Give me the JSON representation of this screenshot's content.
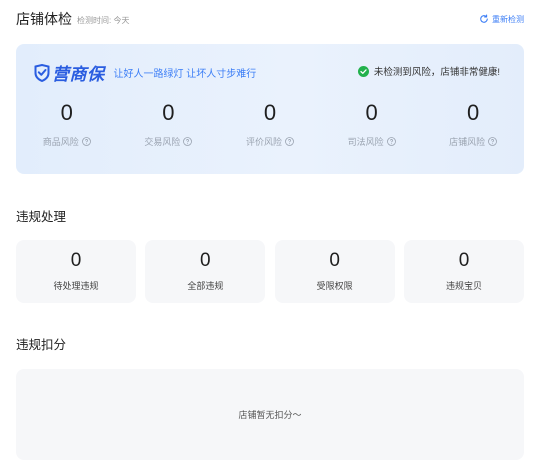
{
  "header": {
    "title": "店铺体检",
    "check_time": "检测时间: 今天",
    "recheck_label": "重新检测",
    "recheck_icon": "refresh-icon"
  },
  "health_card": {
    "brand_name": "营商保",
    "brand_icon": "shield-check-icon",
    "slogan": "让好人一路绿灯 让坏人寸步难行",
    "status_text": "未检测到风险，店铺非常健康!",
    "status_icon": "check-circle-icon",
    "status_color": "#22b14c",
    "risks": [
      {
        "value": "0",
        "label": "商品风险"
      },
      {
        "value": "0",
        "label": "交易风险"
      },
      {
        "value": "0",
        "label": "评价风险"
      },
      {
        "value": "0",
        "label": "司法风险"
      },
      {
        "value": "0",
        "label": "店铺风险"
      }
    ]
  },
  "violations": {
    "title": "违规处理",
    "items": [
      {
        "value": "0",
        "label": "待处理违规"
      },
      {
        "value": "0",
        "label": "全部违规"
      },
      {
        "value": "0",
        "label": "受限权限"
      },
      {
        "value": "0",
        "label": "违规宝贝"
      }
    ]
  },
  "deductions": {
    "title": "违规扣分",
    "empty_text": "店铺暂无扣分～"
  },
  "colors": {
    "accent": "#3c7ef6",
    "brand": "#2a5de0"
  }
}
